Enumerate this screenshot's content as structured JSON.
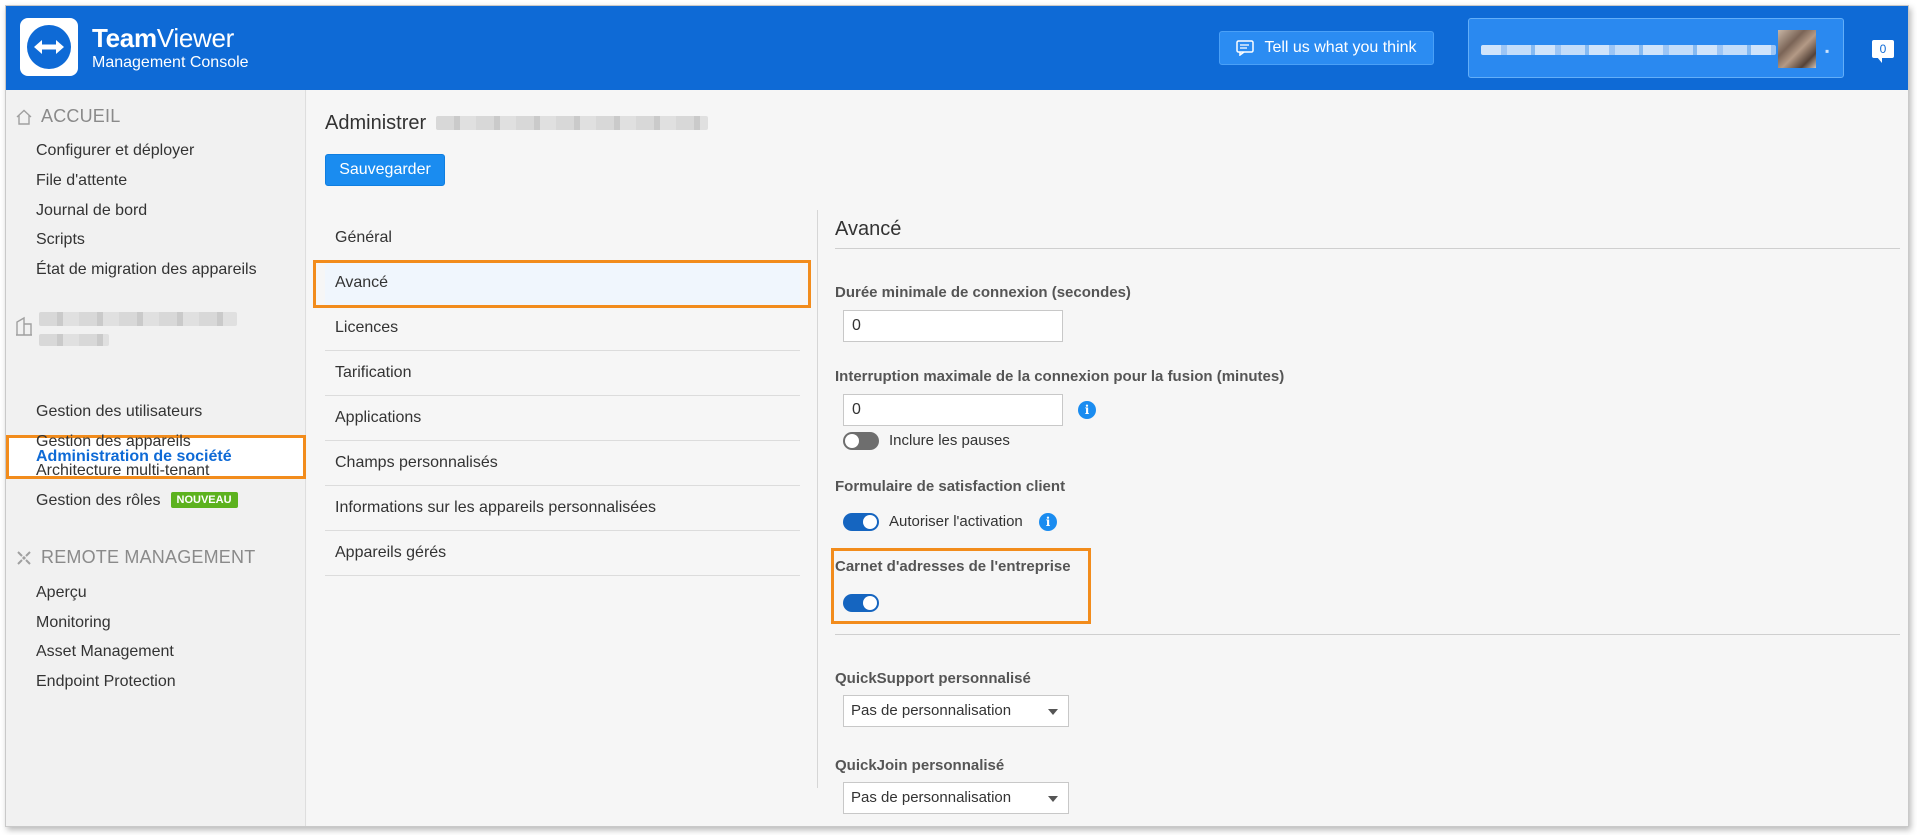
{
  "header": {
    "brand_bold": "Team",
    "brand_rest": "Viewer",
    "brand_sub": "Management Console",
    "feedback_label": "Tell us what you think",
    "notification_count": "0"
  },
  "sidebar": {
    "section_home": "ACCUEIL",
    "home_items": [
      "Configurer et déployer",
      "File d'attente",
      "Journal de bord",
      "Scripts",
      "État de migration des appareils"
    ],
    "company_items": {
      "active": "Administration de société",
      "users": "Gestion des utilisateurs",
      "devices": "Gestion des appareils",
      "tenant": "Architecture multi-tenant",
      "roles": "Gestion des rôles",
      "roles_badge": "NOUVEAU"
    },
    "section_remote": "REMOTE MANAGEMENT",
    "remote_items": [
      "Aperçu",
      "Monitoring",
      "Asset Management",
      "Endpoint Protection"
    ]
  },
  "content": {
    "title_prefix": "Administrer",
    "save_label": "Sauvegarder",
    "menu": [
      "Général",
      "Avancé",
      "Licences",
      "Tarification",
      "Applications",
      "Champs personnalisés",
      "Informations sur les appareils personnalisées",
      "Appareils gérés"
    ],
    "panel": {
      "title": "Avancé",
      "min_duration_label": "Durée minimale de connexion (secondes)",
      "min_duration_value": "0",
      "max_interrupt_label": "Interruption maximale de la connexion pour la fusion (minutes)",
      "max_interrupt_value": "0",
      "include_pauses_label": "Inclure les pauses",
      "include_pauses_on": false,
      "satisfaction_label": "Formulaire de satisfaction client",
      "allow_activation_label": "Autoriser l'activation",
      "allow_activation_on": true,
      "address_book_label": "Carnet d'adresses de l'entreprise",
      "address_book_on": true,
      "quicksupport_label": "QuickSupport personnalisé",
      "quicksupport_value": "Pas de personnalisation",
      "quickjoin_label": "QuickJoin personnalisé",
      "quickjoin_value": "Pas de personnalisation",
      "info_glyph": "i"
    }
  },
  "icons": {
    "home": "home-icon",
    "building": "building-icon",
    "remote": "remote-management-icon",
    "info": "info-icon",
    "feedback": "feedback-icon"
  },
  "colors": {
    "header_blue": "#0e6ad6",
    "accent_blue": "#1a8cf0",
    "highlight_orange": "#f28c1c",
    "badge_green": "#5cb21e"
  }
}
